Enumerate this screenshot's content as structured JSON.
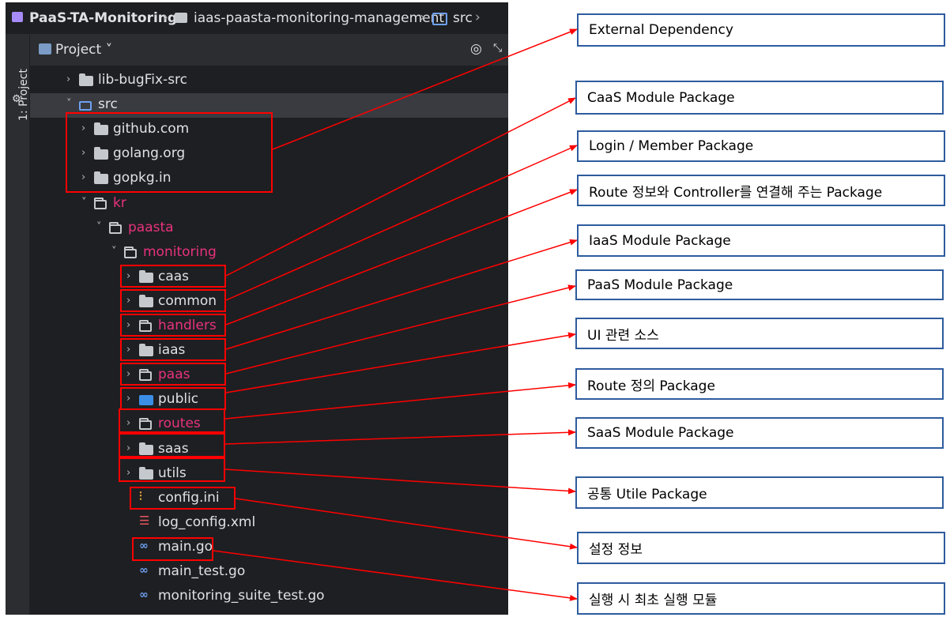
{
  "breadcrumb": {
    "project": "PaaS-TA-Monitoring",
    "module": "iaas-paasta-monitoring-management",
    "folder": "src"
  },
  "sidebar": {
    "label": "1: Project"
  },
  "panel": {
    "title": "Project ˅"
  },
  "tree": [
    {
      "label": "lib-bugFix-src",
      "icon": "folder-icon",
      "pink": false
    },
    {
      "label": "src",
      "icon": "source-folder-icon",
      "pink": false,
      "selected": true,
      "expanded": true
    },
    {
      "label": "github.com",
      "icon": "folder-icon",
      "pink": false
    },
    {
      "label": "golang.org",
      "icon": "folder-icon",
      "pink": false
    },
    {
      "label": "gopkg.in",
      "icon": "folder-icon",
      "pink": false
    },
    {
      "label": "kr",
      "icon": "package-icon",
      "pink": true,
      "expanded": true
    },
    {
      "label": "paasta",
      "icon": "package-icon",
      "pink": true,
      "expanded": true
    },
    {
      "label": "monitoring",
      "icon": "package-icon",
      "pink": true,
      "expanded": true
    },
    {
      "label": "caas",
      "icon": "folder-icon",
      "pink": false
    },
    {
      "label": "common",
      "icon": "folder-icon",
      "pink": false
    },
    {
      "label": "handlers",
      "icon": "package-icon",
      "pink": true
    },
    {
      "label": "iaas",
      "icon": "folder-icon",
      "pink": false
    },
    {
      "label": "paas",
      "icon": "package-icon",
      "pink": true
    },
    {
      "label": "public",
      "icon": "web-folder-icon",
      "pink": false
    },
    {
      "label": "routes",
      "icon": "routes-folder-icon",
      "pink": true
    },
    {
      "label": "saas",
      "icon": "folder-icon",
      "pink": false
    },
    {
      "label": "utils",
      "icon": "folder-icon",
      "pink": false
    },
    {
      "label": "config.ini",
      "icon": "config-file-icon",
      "pink": false
    },
    {
      "label": "log_config.xml",
      "icon": "xml-file-icon",
      "pink": false
    },
    {
      "label": "main.go",
      "icon": "go-file-icon",
      "pink": false
    },
    {
      "label": "main_test.go",
      "icon": "go-file-icon",
      "pink": false
    },
    {
      "label": "monitoring_suite_test.go",
      "icon": "go-file-icon",
      "pink": false
    }
  ],
  "annotations": [
    "External Dependency",
    "CaaS Module Package",
    "Login / Member Package",
    "Route 정보와 Controller를 연결해 주는 Package",
    "IaaS Module Package",
    "PaaS Module Package",
    "UI 관련 소스",
    "Route 정의 Package",
    "SaaS Module Package",
    "공통 Utile Package",
    "설정 정보",
    "실행 시 최초 실행 모듈"
  ],
  "colors": {
    "highlight": "#ff0000",
    "label_border": "#2e5c9e",
    "package_text": "#e8327e",
    "ide_background": "#1e1f22"
  }
}
